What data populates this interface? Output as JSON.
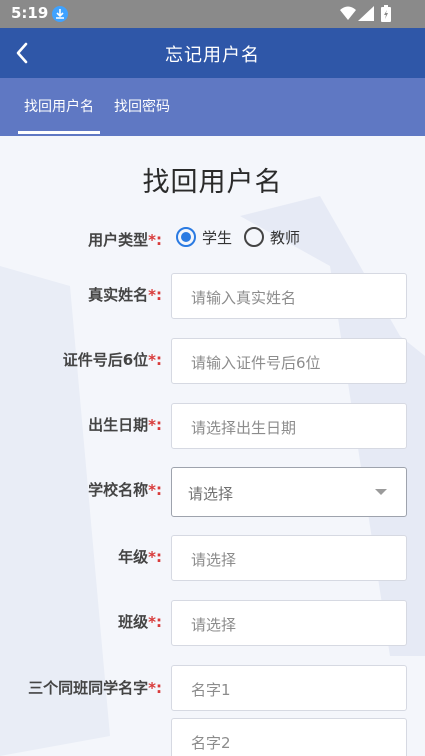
{
  "status_bar": {
    "time": "5:19"
  },
  "header": {
    "title": "忘记用户名"
  },
  "tabs": [
    {
      "label": "找回用户名",
      "active": true
    },
    {
      "label": "找回密码",
      "active": false
    }
  ],
  "form": {
    "title": "找回用户名",
    "required_mark": "*:",
    "user_type": {
      "label": "用户类型",
      "options": [
        "学生",
        "教师"
      ],
      "selected": "学生"
    },
    "real_name": {
      "label": "真实姓名",
      "placeholder": "请输入真实姓名"
    },
    "id_last6": {
      "label": "证件号后6位",
      "placeholder": "请输入证件号后6位"
    },
    "birth_date": {
      "label": "出生日期",
      "placeholder": "请选择出生日期"
    },
    "school": {
      "label": "学校名称",
      "placeholder": "请选择"
    },
    "grade": {
      "label": "年级",
      "placeholder": "请选择"
    },
    "class": {
      "label": "班级",
      "placeholder": "请选择"
    },
    "classmates": {
      "label": "三个同班同学名字",
      "placeholders": [
        "名字1",
        "名字2"
      ]
    }
  },
  "colors": {
    "header_bg": "#2f57a8",
    "tabs_bg": "#5f78c3",
    "required": "#d83b3b",
    "radio_accent": "#2a7ae2"
  }
}
